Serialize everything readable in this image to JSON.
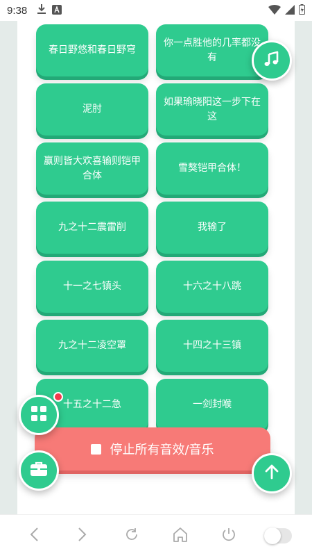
{
  "status_bar": {
    "time": "9:38",
    "left_icons": [
      "download-icon",
      "a-box-icon"
    ],
    "right_icons": [
      "wifi-icon",
      "signal-icon",
      "battery-icon"
    ]
  },
  "tiles": [
    "春日野悠和春日野穹",
    "你一点胜他的几率都没有",
    "泥肘",
    "如果瑜晓阳这一步下在这",
    "赢则皆大欢喜输则铠甲合体",
    "雪獒铠甲合体！",
    "九之十二震雷削",
    "我输了",
    "十一之七镇头",
    "十六之十八跳",
    "九之十二凌空罩",
    "十四之十三镇",
    "十五之十二急",
    "一剑封喉"
  ],
  "stop_button": {
    "label": "停止所有音效/音乐"
  },
  "fabs": {
    "music": "music-note-icon",
    "grid": "grid-icon",
    "toolbox": "toolbox-icon",
    "scroll_top": "arrow-up-icon"
  },
  "colors": {
    "tile": "#2fcb8f",
    "tile_shadow": "#23a977",
    "stop": "#f77a77",
    "badge": "#f2394d"
  },
  "nav_bar": {
    "items": [
      "back-icon",
      "forward-icon",
      "refresh-icon",
      "home-icon",
      "power-icon",
      "toggle-switch"
    ]
  }
}
